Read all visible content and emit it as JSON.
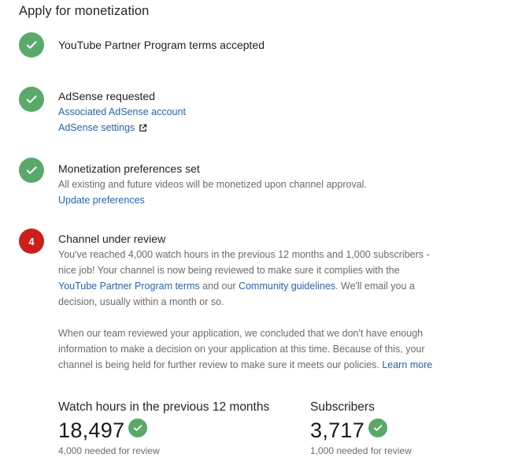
{
  "page": {
    "title": "Apply for monetization"
  },
  "steps": [
    {
      "status": "done",
      "title": "YouTube Partner Program terms accepted"
    },
    {
      "status": "done",
      "title": "AdSense requested",
      "links": [
        "Associated AdSense account",
        "AdSense settings"
      ]
    },
    {
      "status": "done",
      "title": "Monetization preferences set",
      "description": "All existing and future videos will be monetized upon channel approval.",
      "link": "Update preferences"
    },
    {
      "status": "current",
      "number": "4",
      "title": "Channel under review",
      "para1_part1": "You've reached 4,000 watch hours in the previous 12 months and 1,000 subscribers - nice job! Your channel is now being reviewed to make sure it complies with the ",
      "para1_link1": "YouTube Partner Program terms",
      "para1_part2": " and our ",
      "para1_link2": "Community guidelines",
      "para1_part3": ". We'll email you a decision, usually within a month or so.",
      "para2_text": "When our team reviewed your application, we concluded that we don't have enough information to make a decision on your application at this time. Because of this, your channel is being held for further review to make sure it meets our policies. ",
      "para2_link": "Learn more"
    }
  ],
  "stats": {
    "watch_hours": {
      "label": "Watch hours in the previous 12 months",
      "value": "18,497",
      "requirement": "4,000 needed for review"
    },
    "subscribers": {
      "label": "Subscribers",
      "value": "3,717",
      "requirement": "1,000 needed for review"
    }
  },
  "colors": {
    "done_badge": "#5ba96a",
    "current_badge": "#cc1f1a",
    "link": "#2865a8"
  },
  "icons": {
    "done": "checkmark-icon",
    "external": "external-link-icon"
  }
}
